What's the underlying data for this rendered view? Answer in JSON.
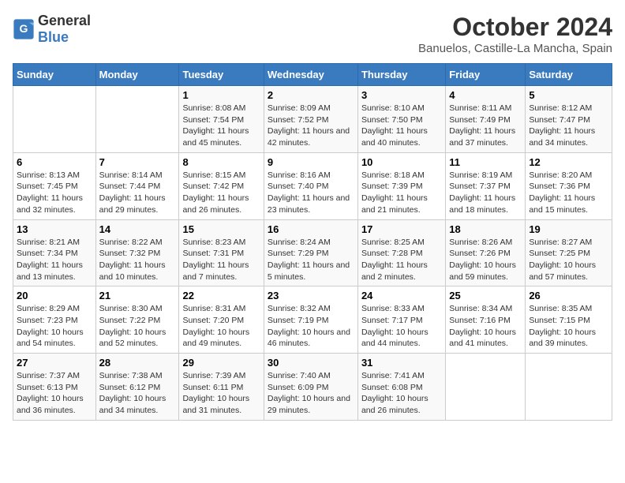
{
  "header": {
    "logo_general": "General",
    "logo_blue": "Blue",
    "title": "October 2024",
    "subtitle": "Banuelos, Castille-La Mancha, Spain"
  },
  "days_of_week": [
    "Sunday",
    "Monday",
    "Tuesday",
    "Wednesday",
    "Thursday",
    "Friday",
    "Saturday"
  ],
  "weeks": [
    [
      {
        "num": "",
        "detail": ""
      },
      {
        "num": "",
        "detail": ""
      },
      {
        "num": "1",
        "detail": "Sunrise: 8:08 AM\nSunset: 7:54 PM\nDaylight: 11 hours and 45 minutes."
      },
      {
        "num": "2",
        "detail": "Sunrise: 8:09 AM\nSunset: 7:52 PM\nDaylight: 11 hours and 42 minutes."
      },
      {
        "num": "3",
        "detail": "Sunrise: 8:10 AM\nSunset: 7:50 PM\nDaylight: 11 hours and 40 minutes."
      },
      {
        "num": "4",
        "detail": "Sunrise: 8:11 AM\nSunset: 7:49 PM\nDaylight: 11 hours and 37 minutes."
      },
      {
        "num": "5",
        "detail": "Sunrise: 8:12 AM\nSunset: 7:47 PM\nDaylight: 11 hours and 34 minutes."
      }
    ],
    [
      {
        "num": "6",
        "detail": "Sunrise: 8:13 AM\nSunset: 7:45 PM\nDaylight: 11 hours and 32 minutes."
      },
      {
        "num": "7",
        "detail": "Sunrise: 8:14 AM\nSunset: 7:44 PM\nDaylight: 11 hours and 29 minutes."
      },
      {
        "num": "8",
        "detail": "Sunrise: 8:15 AM\nSunset: 7:42 PM\nDaylight: 11 hours and 26 minutes."
      },
      {
        "num": "9",
        "detail": "Sunrise: 8:16 AM\nSunset: 7:40 PM\nDaylight: 11 hours and 23 minutes."
      },
      {
        "num": "10",
        "detail": "Sunrise: 8:18 AM\nSunset: 7:39 PM\nDaylight: 11 hours and 21 minutes."
      },
      {
        "num": "11",
        "detail": "Sunrise: 8:19 AM\nSunset: 7:37 PM\nDaylight: 11 hours and 18 minutes."
      },
      {
        "num": "12",
        "detail": "Sunrise: 8:20 AM\nSunset: 7:36 PM\nDaylight: 11 hours and 15 minutes."
      }
    ],
    [
      {
        "num": "13",
        "detail": "Sunrise: 8:21 AM\nSunset: 7:34 PM\nDaylight: 11 hours and 13 minutes."
      },
      {
        "num": "14",
        "detail": "Sunrise: 8:22 AM\nSunset: 7:32 PM\nDaylight: 11 hours and 10 minutes."
      },
      {
        "num": "15",
        "detail": "Sunrise: 8:23 AM\nSunset: 7:31 PM\nDaylight: 11 hours and 7 minutes."
      },
      {
        "num": "16",
        "detail": "Sunrise: 8:24 AM\nSunset: 7:29 PM\nDaylight: 11 hours and 5 minutes."
      },
      {
        "num": "17",
        "detail": "Sunrise: 8:25 AM\nSunset: 7:28 PM\nDaylight: 11 hours and 2 minutes."
      },
      {
        "num": "18",
        "detail": "Sunrise: 8:26 AM\nSunset: 7:26 PM\nDaylight: 10 hours and 59 minutes."
      },
      {
        "num": "19",
        "detail": "Sunrise: 8:27 AM\nSunset: 7:25 PM\nDaylight: 10 hours and 57 minutes."
      }
    ],
    [
      {
        "num": "20",
        "detail": "Sunrise: 8:29 AM\nSunset: 7:23 PM\nDaylight: 10 hours and 54 minutes."
      },
      {
        "num": "21",
        "detail": "Sunrise: 8:30 AM\nSunset: 7:22 PM\nDaylight: 10 hours and 52 minutes."
      },
      {
        "num": "22",
        "detail": "Sunrise: 8:31 AM\nSunset: 7:20 PM\nDaylight: 10 hours and 49 minutes."
      },
      {
        "num": "23",
        "detail": "Sunrise: 8:32 AM\nSunset: 7:19 PM\nDaylight: 10 hours and 46 minutes."
      },
      {
        "num": "24",
        "detail": "Sunrise: 8:33 AM\nSunset: 7:17 PM\nDaylight: 10 hours and 44 minutes."
      },
      {
        "num": "25",
        "detail": "Sunrise: 8:34 AM\nSunset: 7:16 PM\nDaylight: 10 hours and 41 minutes."
      },
      {
        "num": "26",
        "detail": "Sunrise: 8:35 AM\nSunset: 7:15 PM\nDaylight: 10 hours and 39 minutes."
      }
    ],
    [
      {
        "num": "27",
        "detail": "Sunrise: 7:37 AM\nSunset: 6:13 PM\nDaylight: 10 hours and 36 minutes."
      },
      {
        "num": "28",
        "detail": "Sunrise: 7:38 AM\nSunset: 6:12 PM\nDaylight: 10 hours and 34 minutes."
      },
      {
        "num": "29",
        "detail": "Sunrise: 7:39 AM\nSunset: 6:11 PM\nDaylight: 10 hours and 31 minutes."
      },
      {
        "num": "30",
        "detail": "Sunrise: 7:40 AM\nSunset: 6:09 PM\nDaylight: 10 hours and 29 minutes."
      },
      {
        "num": "31",
        "detail": "Sunrise: 7:41 AM\nSunset: 6:08 PM\nDaylight: 10 hours and 26 minutes."
      },
      {
        "num": "",
        "detail": ""
      },
      {
        "num": "",
        "detail": ""
      }
    ]
  ]
}
